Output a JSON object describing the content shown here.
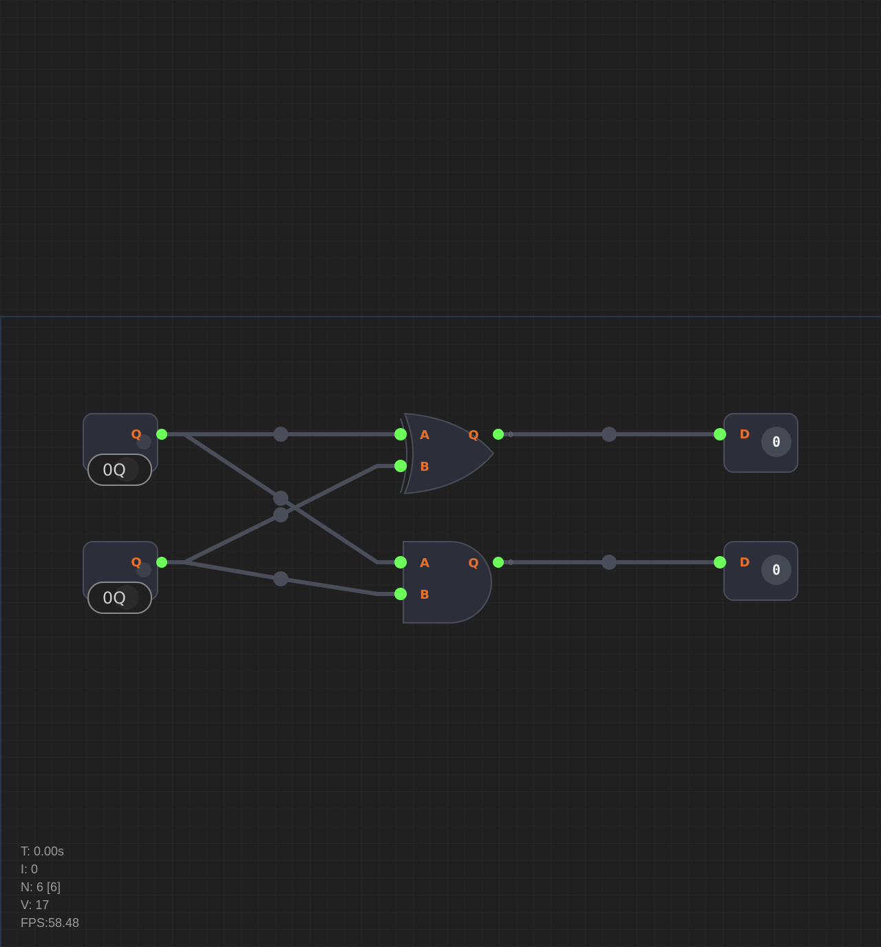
{
  "colors": {
    "background": "#202020",
    "grid": "#2a2a2a",
    "region_border": "#243852",
    "node_fill": "#2c2f3a",
    "node_stroke": "#4a4e5a",
    "wire": "#4a4e5a",
    "active_pin": "#6cff5a",
    "pin_label": "#e8702a",
    "stats_text": "#9a9a9a"
  },
  "inputs": [
    {
      "pin_label": "Q",
      "toggle_text": "0Q"
    },
    {
      "pin_label": "Q",
      "toggle_text": "0Q"
    }
  ],
  "gates": [
    {
      "type": "OR",
      "inputs": [
        "A",
        "B"
      ],
      "output": "Q",
      "output_value": "0"
    },
    {
      "type": "AND",
      "inputs": [
        "A",
        "B"
      ],
      "output": "Q",
      "output_value": "0"
    }
  ],
  "outputs": [
    {
      "pin_label": "D",
      "display": "0"
    },
    {
      "pin_label": "D",
      "display": "0"
    }
  ],
  "stats": {
    "time": "T: 0.00s",
    "iterations": "I: 0",
    "nodes": "N: 6 [6]",
    "vertices": "V: 17",
    "fps": "FPS:58.48"
  }
}
